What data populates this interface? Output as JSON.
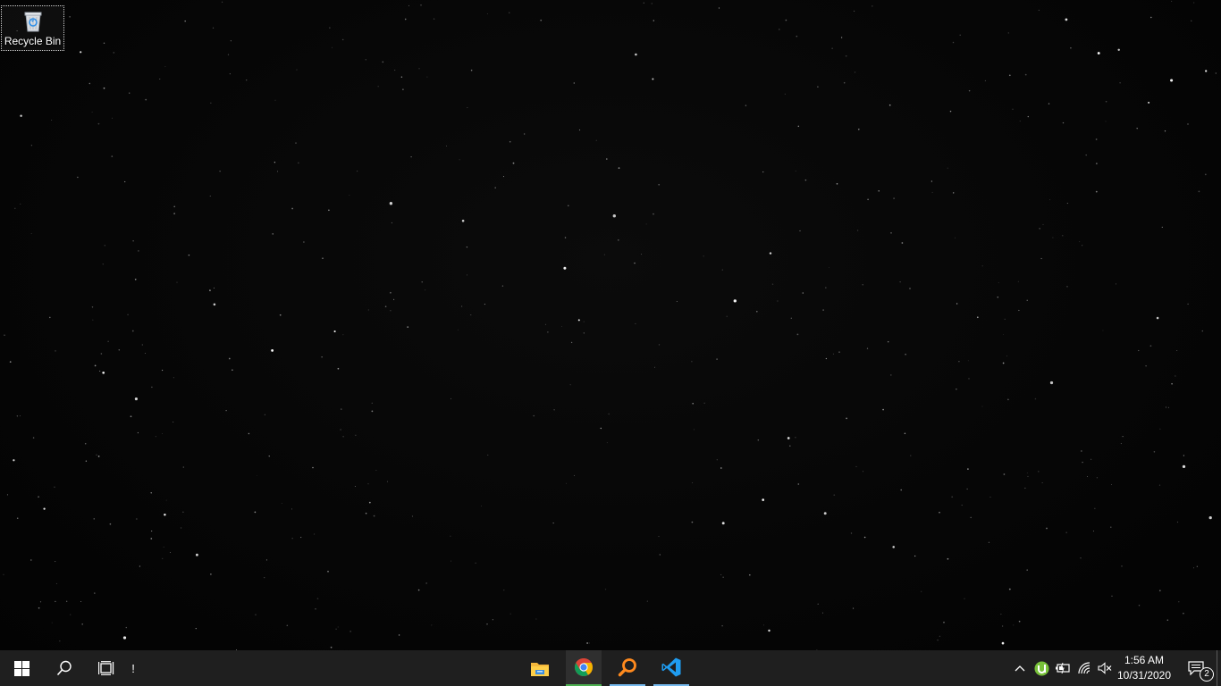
{
  "desktop": {
    "icons": [
      {
        "label": "Recycle Bin",
        "icon": "recycle-bin-icon"
      }
    ]
  },
  "taskbar": {
    "start_icon": "windows-logo-icon",
    "search_icon": "search-icon",
    "task_view_icon": "task-view-icon",
    "alert_text": "!",
    "pinned_apps": [
      {
        "name": "File Explorer",
        "icon": "file-explorer-icon"
      },
      {
        "name": "Google Chrome",
        "icon": "chrome-icon"
      },
      {
        "name": "Everything Search",
        "icon": "magnifier-app-icon"
      },
      {
        "name": "Visual Studio Code",
        "icon": "vscode-icon"
      }
    ],
    "tray": {
      "show_hidden_icon": "chevron-up-icon",
      "utorrent_icon": "utorrent-icon",
      "battery_icon": "battery-icon",
      "network_icon": "wifi-icon",
      "volume_icon": "volume-muted-icon",
      "time": "1:56 AM",
      "date": "10/31/2020",
      "notifications_icon": "action-center-icon",
      "notification_count": "2"
    }
  },
  "colors": {
    "taskbar": "#1f1f1f",
    "accent": "#0078d7",
    "running_underline": "#76b9ed"
  }
}
